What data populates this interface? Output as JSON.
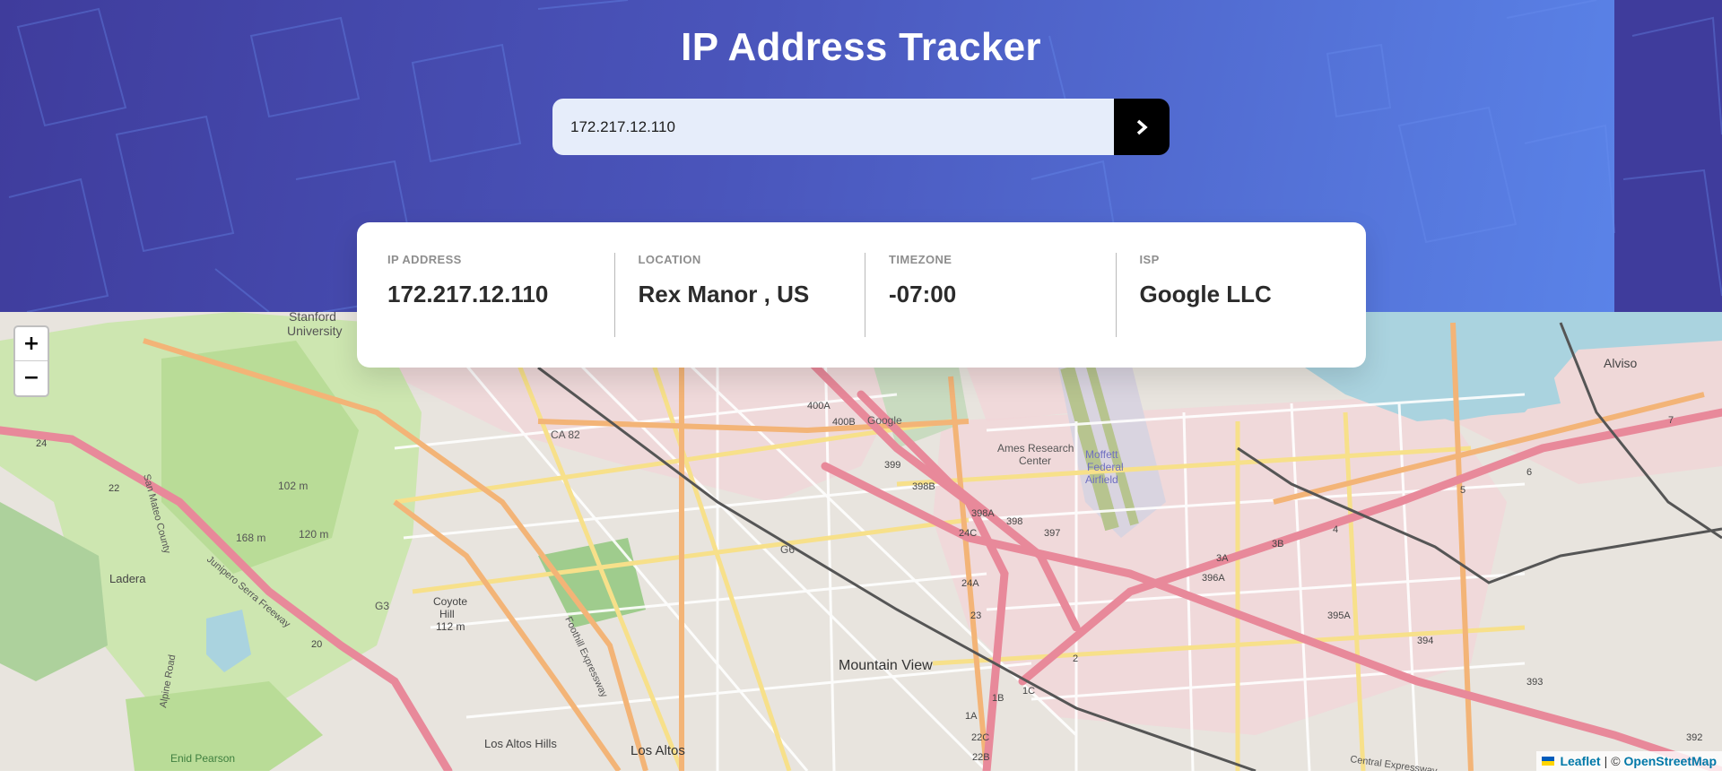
{
  "header": {
    "title": "IP Address Tracker",
    "search": {
      "value": "172.217.12.110",
      "button_icon": "chevron-right-icon"
    }
  },
  "info": [
    {
      "label": "IP Address",
      "value": "172.217.12.110"
    },
    {
      "label": "Location",
      "value": "Rex Manor , US"
    },
    {
      "label": "Timezone",
      "value": "-07:00"
    },
    {
      "label": "ISP",
      "value": "Google LLC"
    }
  ],
  "map": {
    "zoom_in": "+",
    "zoom_out": "−",
    "labels": {
      "mountain_view": "Mountain View",
      "stanford": "Stanford",
      "university": "University",
      "los_altos": "Los Altos",
      "los_altos_hills": "Los Altos Hills",
      "ladera": "Ladera",
      "alviso": "Alviso",
      "ames": "Ames Research",
      "ames2": "Center",
      "moffett": "Moffett",
      "moffett2": "Federal",
      "moffett3": "Airfield",
      "google": "Google",
      "coyote": "Coyote",
      "coyote2": "Hill",
      "coyote3": "112 m",
      "ca82": "CA 82",
      "g6": "G6",
      "g3": "G3",
      "peak1": "102 m",
      "peak2": "168 m",
      "peak3": "120 m",
      "enid": "Enid Pearson",
      "junipero": "Junipero Serra Freeway",
      "foothill": "Foothill Expressway",
      "central": "Central Expressway",
      "alpine": "Alpine Road",
      "sanmateo": "San Mateo County",
      "r400A": "400A",
      "r400B": "400B",
      "r399": "399",
      "r398B": "398B",
      "r398A": "398A",
      "r398": "398",
      "r397": "397",
      "r396A": "396A",
      "r395A": "395A",
      "r394": "394",
      "r393": "393",
      "r392": "392",
      "r24": "24",
      "r22": "22",
      "r20": "20",
      "r24C": "24C",
      "r24A": "24A",
      "r23": "23",
      "r22C": "22C",
      "r22B": "22B",
      "r3A": "3A",
      "r3B": "3B",
      "r4": "4",
      "r5": "5",
      "r6": "6",
      "r7": "7",
      "r2": "2",
      "r1C": "1C",
      "r1B": "1B",
      "r1A": "1A"
    },
    "attribution": {
      "leaflet": "Leaflet",
      "separator": "|",
      "copyright": "©",
      "osm": "OpenStreetMap"
    }
  }
}
